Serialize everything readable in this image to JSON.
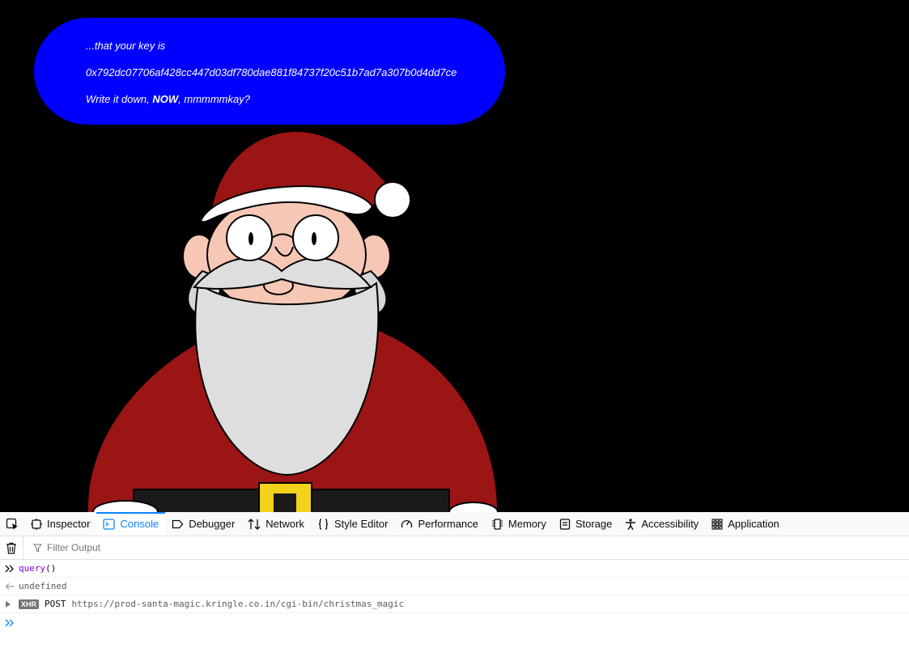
{
  "bubble": {
    "line1": "...that your key is",
    "key": "0x792dc07706af428cc447d03df780dae881f84737f20c51b7ad7a307b0d4dd7ce",
    "line3_pre": "Write it down, ",
    "line3_bold": "NOW",
    "line3_post": ", mmmmmkay?"
  },
  "devtools": {
    "tabs": [
      {
        "label": "Inspector",
        "icon": "inspector-icon"
      },
      {
        "label": "Console",
        "icon": "console-icon",
        "active": true
      },
      {
        "label": "Debugger",
        "icon": "debugger-icon"
      },
      {
        "label": "Network",
        "icon": "network-icon"
      },
      {
        "label": "Style Editor",
        "icon": "style-editor-icon"
      },
      {
        "label": "Performance",
        "icon": "performance-icon"
      },
      {
        "label": "Memory",
        "icon": "memory-icon"
      },
      {
        "label": "Storage",
        "icon": "storage-icon"
      },
      {
        "label": "Accessibility",
        "icon": "accessibility-icon"
      },
      {
        "label": "Application",
        "icon": "application-icon"
      }
    ],
    "filter_placeholder": "Filter Output",
    "console": {
      "input_fn": "query",
      "input_parens": "()",
      "result": "undefined",
      "xhr_badge": "XHR",
      "xhr_method": "POST",
      "xhr_url": "https://prod-santa-magic.kringle.co.in/cgi-bin/christmas_magic"
    }
  },
  "colors": {
    "bubble": "#0000ff",
    "active_tab": "#0a84ff",
    "santa_red": "#9b1515",
    "beard": "#dedede"
  }
}
